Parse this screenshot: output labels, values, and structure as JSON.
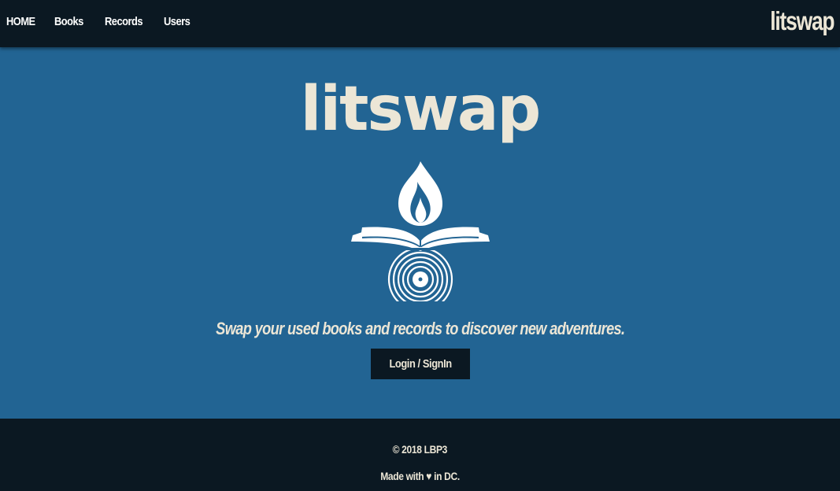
{
  "nav": {
    "items": [
      {
        "label": "HOME"
      },
      {
        "label": "Books"
      },
      {
        "label": "Records"
      },
      {
        "label": "Users"
      }
    ],
    "brand": "litswap"
  },
  "hero": {
    "title": "litswap",
    "logo_icon": "book-flame-record-icon",
    "tagline": "Swap your used books and records to discover new adventures.",
    "login_label": "Login / SignIn"
  },
  "footer": {
    "copyright": "© 2018 LBP3",
    "made_with_prefix": "Made with",
    "heart_icon": "heart-icon",
    "heart_glyph": "♥",
    "made_with_suffix": "in DC."
  },
  "colors": {
    "navbar_bg": "#0b1822",
    "hero_bg": "#226493",
    "cream": "#ece6d6",
    "white": "#ffffff"
  }
}
